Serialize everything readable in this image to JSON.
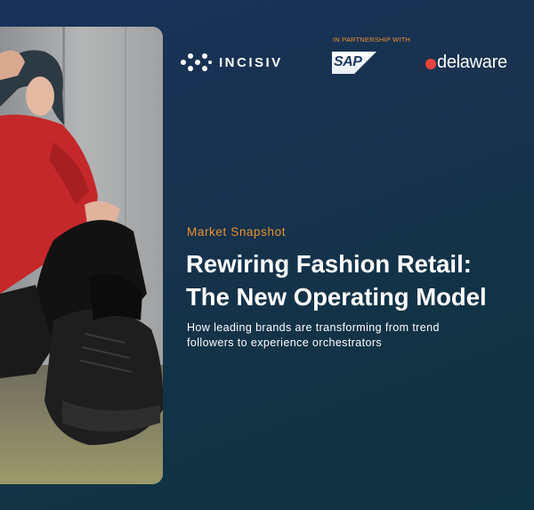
{
  "brand": {
    "primary_logo": "INCISIV",
    "partnership_label": "IN PARTNERSHIP WITH",
    "partner_logos": [
      "SAP",
      "delaware"
    ]
  },
  "hero": {
    "eyebrow": "Market Snapshot",
    "title_line1": "Rewiring Fashion Retail:",
    "title_line2": "The New Operating Model",
    "subtitle_line1": "How leading brands are transforming from trend",
    "subtitle_line2": "followers to experience orchestrators"
  },
  "colors": {
    "background": "#17324f",
    "accent_orange": "#e8922e",
    "sap_blue": "#1b7bd1",
    "delaware_red": "#e8433c",
    "text": "#ffffff"
  },
  "image": {
    "subject": "fashion-photo"
  }
}
